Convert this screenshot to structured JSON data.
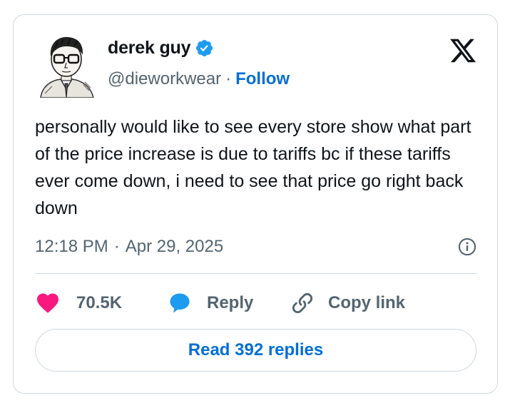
{
  "author": {
    "display_name": "derek guy",
    "handle": "@dieworkwear",
    "separator": "·",
    "follow_label": "Follow",
    "verified": true,
    "verified_color": "#1d9bf0"
  },
  "tweet": {
    "text": "personally would like to see every store show what part of the price increase is due to tariffs bc if these tariffs ever come down, i need to see that price go right back down",
    "time": "12:18 PM",
    "date_separator": "·",
    "date": "Apr 29, 2025"
  },
  "actions": {
    "like_count": "70.5K",
    "reply_label": "Reply",
    "copy_label": "Copy link",
    "like_color": "#f91880",
    "reply_color": "#1d9bf0"
  },
  "read_replies_label": "Read 392 replies",
  "icons": [
    "avatar-illustration",
    "verified-badge-icon",
    "x-logo-icon",
    "info-icon",
    "heart-icon",
    "reply-bubble-icon",
    "link-icon"
  ]
}
